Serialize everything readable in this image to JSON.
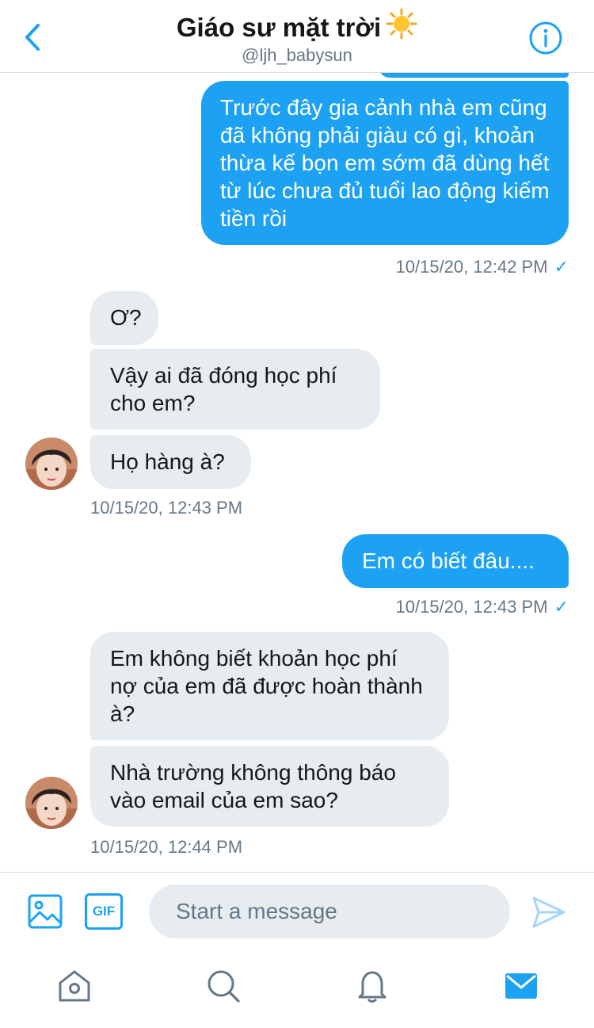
{
  "header": {
    "title": "Giáo sư mặt trời",
    "title_emoji": "sun-icon",
    "handle": "@ljh_babysun"
  },
  "messages": [
    {
      "dir": "out",
      "text": "Trước đây gia cảnh nhà em cũng đã không phải giàu có gì, khoản thừa kế bọn em sớm đã dùng hết từ lúc chưa đủ tuổi lao động kiếm tiền rồi"
    },
    {
      "dir": "out",
      "timestamp": "10/15/20, 12:42 PM",
      "check": "✓"
    },
    {
      "dir": "in",
      "text": "Ơ?"
    },
    {
      "dir": "in",
      "text": "Vậy ai đã đóng học phí cho em?"
    },
    {
      "dir": "in",
      "text": "Họ hàng à?"
    },
    {
      "dir": "in",
      "timestamp": "10/15/20, 12:43 PM"
    },
    {
      "dir": "out",
      "text": "Em có biết đâu...."
    },
    {
      "dir": "out",
      "timestamp": "10/15/20, 12:43 PM",
      "check": "✓"
    },
    {
      "dir": "in",
      "text": "Em không biết khoản học phí nợ của em đã được hoàn thành à?"
    },
    {
      "dir": "in",
      "text": "Nhà trường không thông báo vào email của em sao?"
    },
    {
      "dir": "in",
      "timestamp": "10/15/20, 12:44 PM"
    }
  ],
  "composer": {
    "placeholder": "Start a message",
    "gif_label": "GIF"
  },
  "tabs": [
    "home-icon",
    "search-icon",
    "bell-icon",
    "mail-icon"
  ],
  "colors": {
    "accent": "#1da1f2",
    "bubble_in": "#e6ecf0",
    "muted_text": "#657786"
  }
}
